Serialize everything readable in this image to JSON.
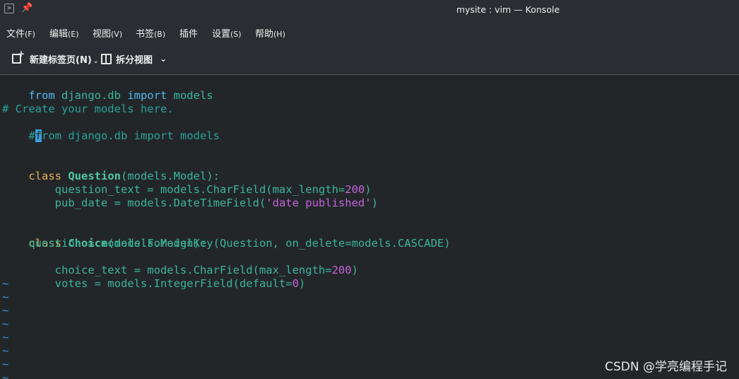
{
  "window": {
    "title": "mysite : vim — Konsole",
    "terminal_icon": ">"
  },
  "menu": {
    "items": [
      {
        "label": "文件",
        "accel": "(F)"
      },
      {
        "label": "编辑",
        "accel": "(E)"
      },
      {
        "label": "视图",
        "accel": "(V)"
      },
      {
        "label": "书签",
        "accel": "(B)"
      },
      {
        "label": "插件",
        "accel": ""
      },
      {
        "label": "设置",
        "accel": "(S)"
      },
      {
        "label": "帮助",
        "accel": "(H)"
      }
    ]
  },
  "toolbar": {
    "new_tab_label": "新建标签页(N)",
    "split_view_label": "拆分视图"
  },
  "editor": {
    "l1": {
      "kw1": "from",
      "mid": " django.db ",
      "kw2": "import",
      "end": " models"
    },
    "l3": "# Create your models here.",
    "l4": {
      "hash": "#",
      "cursor": "f",
      "rest": "rom django.db import models"
    },
    "class1": {
      "kw": "class",
      "name": "Question",
      "base": "(models.Model):"
    },
    "q_text": {
      "pre": "    question_text = models.CharField(max_length=",
      "num": "200",
      "post": ")"
    },
    "q_date": {
      "pre": "    pub_date = models.DateTimeField(",
      "str": "'date published'",
      "post": ")"
    },
    "class2": {
      "kw": "class",
      "name": "Choice",
      "base": "(models.Model):"
    },
    "c_question": "    question = models.ForeignKey(Question, on_delete=models.CASCADE)",
    "c_text": {
      "pre": "    choice_text = models.CharField(max_length=",
      "num": "200",
      "post": ")"
    },
    "c_votes": {
      "pre": "    votes = models.IntegerField(default=",
      "num": "0",
      "post": ")"
    },
    "tilde": "~"
  },
  "watermark": "CSDN @学亮编程手记",
  "colors": {
    "background": "#232629",
    "keyword": "#56b6f0",
    "class_keyword": "#e5b45c",
    "identifier": "#3bb59a",
    "number_string": "#c264d8",
    "cursor": "#3ba0d8",
    "tilde": "#3b8fd6"
  }
}
